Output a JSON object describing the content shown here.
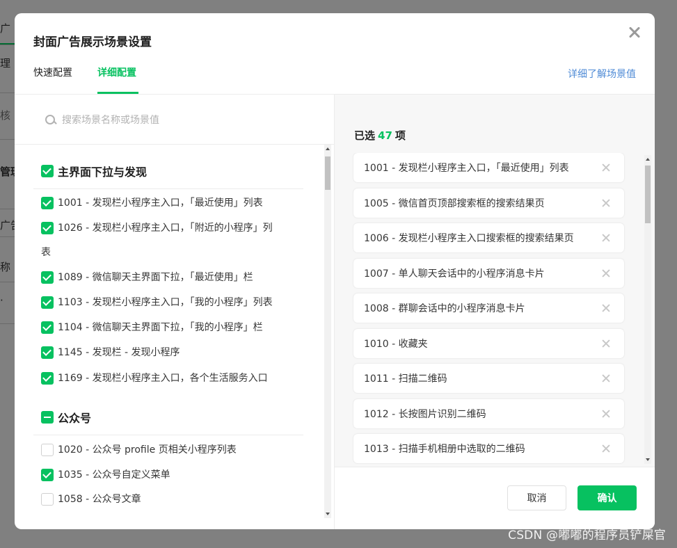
{
  "background": {
    "fragments": [
      "广",
      "理",
      "核 ·",
      "管理",
      "广告",
      "称",
      "·"
    ]
  },
  "dialog": {
    "title": "封面广告展示场景设置",
    "tabs": [
      {
        "label": "快速配置",
        "active": false
      },
      {
        "label": "详细配置",
        "active": true
      }
    ],
    "learn_link": "详细了解场景值",
    "search": {
      "placeholder": "搜索场景名称或场景值"
    },
    "groups": [
      {
        "name": "主界面下拉与发现",
        "state": "checked",
        "items": [
          {
            "label": "1001 - 发现栏小程序主入口，「最近使用」列表",
            "checked": true
          },
          {
            "label": "1026 - 发现栏小程序主入口，「附近的小程序」列",
            "label_cont": "表",
            "checked": true
          },
          {
            "label": "1089 - 微信聊天主界面下拉，「最近使用」栏",
            "checked": true
          },
          {
            "label": "1103 - 发现栏小程序主入口，「我的小程序」列表",
            "checked": true
          },
          {
            "label": "1104 - 微信聊天主界面下拉，「我的小程序」栏",
            "checked": true
          },
          {
            "label": "1145 - 发现栏 - 发现小程序",
            "checked": true
          },
          {
            "label": "1169 - 发现栏小程序主入口，各个生活服务入口",
            "checked": true
          }
        ]
      },
      {
        "name": "公众号",
        "state": "partial",
        "items": [
          {
            "label": "1020 - 公众号 profile 页相关小程序列表",
            "checked": false
          },
          {
            "label": "1035 - 公众号自定义菜单",
            "checked": true
          },
          {
            "label": "1058 - 公众号文章",
            "checked": false
          }
        ]
      }
    ],
    "selected": {
      "prefix": "已选",
      "count": "47",
      "suffix": "项",
      "items": [
        "1001 - 发现栏小程序主入口，「最近使用」列表",
        "1005 - 微信首页顶部搜索框的搜索结果页",
        "1006 - 发现栏小程序主入口搜索框的搜索结果页",
        "1007 - 单人聊天会话中的小程序消息卡片",
        "1008 - 群聊会话中的小程序消息卡片",
        "1010 - 收藏夹",
        "1011 - 扫描二维码",
        "1012 - 长按图片识别二维码",
        "1013 - 扫描手机相册中选取的二维码",
        ""
      ]
    },
    "buttons": {
      "cancel": "取消",
      "confirm": "确认"
    }
  },
  "watermark": "CSDN @嘟嘟的程序员铲屎官",
  "colors": {
    "accent": "#07c160",
    "link": "#4f8bd6"
  }
}
